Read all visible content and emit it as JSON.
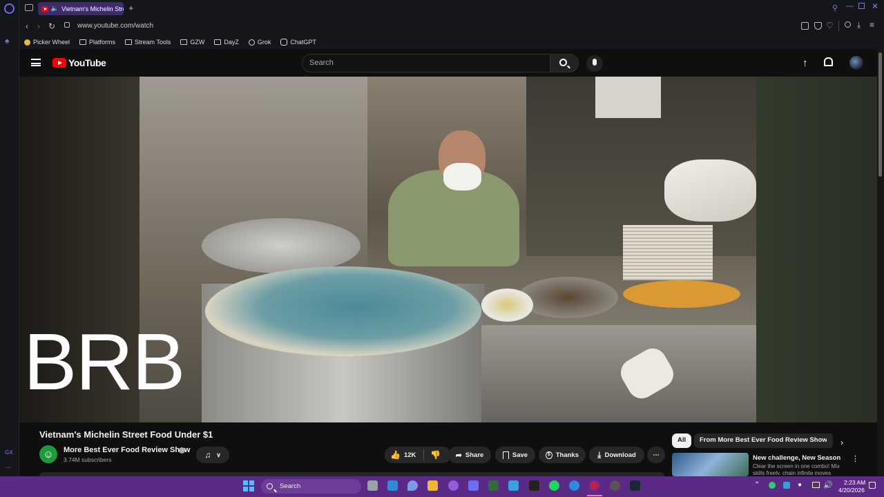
{
  "browser": {
    "tab_title": "Vietnam's Michelin Stre",
    "url": "www.youtube.com/watch",
    "sidebar_gx": "GX",
    "sidebar_more": "...",
    "bookmarks": [
      {
        "label": "Picker Wheel",
        "icon": "picker-wheel-icon"
      },
      {
        "label": "Platforms",
        "icon": "folder-icon"
      },
      {
        "label": "Stream Tools",
        "icon": "folder-icon"
      },
      {
        "label": "GZW",
        "icon": "folder-icon"
      },
      {
        "label": "DayZ",
        "icon": "folder-icon"
      },
      {
        "label": "Grok",
        "icon": "grok-icon"
      },
      {
        "label": "ChatGPT",
        "icon": "chatgpt-icon"
      }
    ]
  },
  "youtube": {
    "logo_text": "YouTube",
    "search_placeholder": "Search",
    "overlay_text": "BRB",
    "video_title": "Vietnam's Michelin Street Food Under $1",
    "channel_name": "More Best Ever Food Review Show",
    "subscribers": "3.74M subscribers",
    "likes": "12K",
    "actions": {
      "share": "Share",
      "save": "Save",
      "thanks": "Thanks",
      "download": "Download"
    },
    "chips": {
      "all": "All",
      "from": "From More Best Ever Food Review Show"
    },
    "recommendation": {
      "title": "New challenge, New Season",
      "desc": "Clear the screen in one combo! Mix skills freely, chain infinite moves"
    }
  },
  "taskbar": {
    "search_label": "Search",
    "time": "2:23 AM",
    "date": "4/20/2026"
  },
  "colors": {
    "accent": "#5b2a86",
    "tab": "#3f2a6e",
    "yt_red": "#ff0000",
    "channel_avatar": "#1f9a3c"
  }
}
